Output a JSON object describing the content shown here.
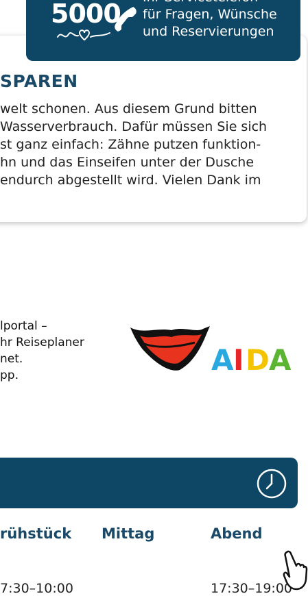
{
  "service": {
    "number": "5000",
    "lines": [
      "Ihr Servicetelefon",
      "für Fragen, Wünsche",
      "und Reservierungen"
    ]
  },
  "water": {
    "title": "SPAREN",
    "lines": [
      "welt schonen. Aus diesem Grund bitten",
      "Wasserverbrauch. Dafür müssen Sie sich",
      "st ganz einfach: Zähne putzen funktion-",
      "hn und das Einseifen unter der Dusche",
      "endurch abgestellt wird. Vielen Dank im"
    ]
  },
  "portal": {
    "lines": [
      "lportal –",
      "hr Reiseplaner",
      "net.",
      "pp."
    ]
  },
  "logo": {
    "text": "AIDA",
    "letter_colors": [
      "#2aa8e0",
      "#e8262a",
      "#f5c400",
      "#5cb531"
    ]
  },
  "meals": {
    "headings": [
      "rühstück",
      "Mittag",
      "Abend"
    ],
    "times": [
      "7:30–10:00",
      "",
      "17:30–19:00"
    ]
  },
  "colors": {
    "brand_dark": "#0e4765",
    "heading": "#1b4a68"
  },
  "icons": [
    "phone-icon",
    "heart-squiggle-icon",
    "clock-icon",
    "hand-pointer-icon"
  ]
}
